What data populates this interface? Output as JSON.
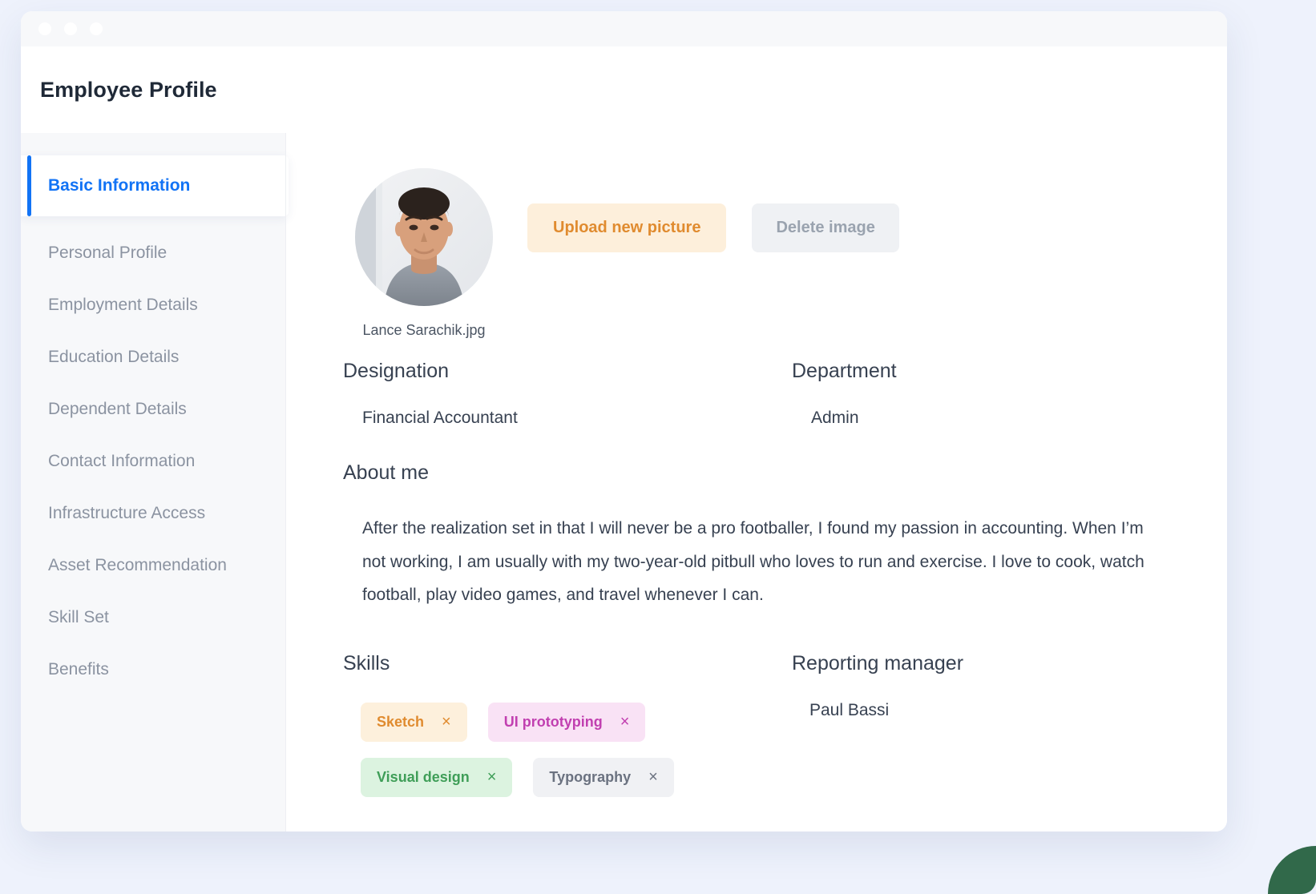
{
  "window": {
    "dots": [
      "close-dot",
      "minimize-dot",
      "maximize-dot"
    ],
    "app_title": "Employee Profile"
  },
  "sidebar": {
    "items": [
      {
        "label": "Basic Information",
        "active": true
      },
      {
        "label": "Personal Profile",
        "active": false
      },
      {
        "label": "Employment Details",
        "active": false
      },
      {
        "label": "Education Details",
        "active": false
      },
      {
        "label": "Dependent Details",
        "active": false
      },
      {
        "label": "Contact Information",
        "active": false
      },
      {
        "label": "Infrastructure Access",
        "active": false
      },
      {
        "label": "Asset Recommendation",
        "active": false
      },
      {
        "label": "Skill Set",
        "active": false
      },
      {
        "label": "Benefits",
        "active": false
      }
    ]
  },
  "profile": {
    "photo_filename": "Lance Sarachik.jpg",
    "upload_button": "Upload new picture",
    "delete_button": "Delete image",
    "designation_label": "Designation",
    "designation_value": "Financial Accountant",
    "department_label": "Department",
    "department_value": "Admin",
    "about_label": "About me",
    "about_text": "After the realization set in that I will never be a pro footballer, I found my passion in accounting. When I’m not working, I am usually with my two-year-old pitbull who loves to run and exercise. I love to cook, watch football, play video games, and travel whenever I can.",
    "skills_label": "Skills",
    "skills": [
      {
        "label": "Sketch",
        "remove": "×",
        "style": "tag-orange"
      },
      {
        "label": "UI prototyping",
        "remove": "×",
        "style": "tag-pink"
      },
      {
        "label": "Visual design",
        "remove": "×",
        "style": "tag-green"
      },
      {
        "label": "Typography",
        "remove": "×",
        "style": "tag-gray"
      }
    ],
    "manager_label": "Reporting manager",
    "manager_value": "Paul Bassi"
  },
  "colors": {
    "accent_blue": "#1273f5",
    "upload_orange": "#e08b2f",
    "upload_bg": "#fdefdb",
    "page_bg": "#eef2fc",
    "corner_green": "#31694a"
  }
}
